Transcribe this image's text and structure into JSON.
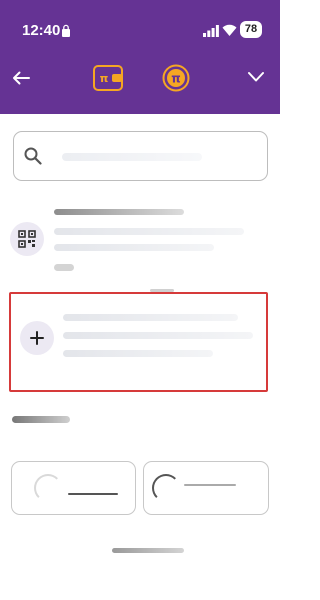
{
  "status_bar": {
    "time": "12:40",
    "battery": "78"
  },
  "nav": {
    "back_icon": "back-arrow-icon",
    "tabs": [
      "wallet-pi-icon",
      "pi-coin-icon"
    ],
    "menu_icon": "chevron-down-icon"
  },
  "search": {
    "placeholder": "",
    "value": ""
  },
  "options": [
    {
      "icon": "qr-code-icon",
      "label": ""
    },
    {
      "icon": "plus-icon",
      "label": ""
    }
  ],
  "contacts": {
    "cards": [
      "",
      ""
    ]
  },
  "colors": {
    "header": "#653394",
    "accent": "#f5a623",
    "highlight": "#d63a3a"
  }
}
